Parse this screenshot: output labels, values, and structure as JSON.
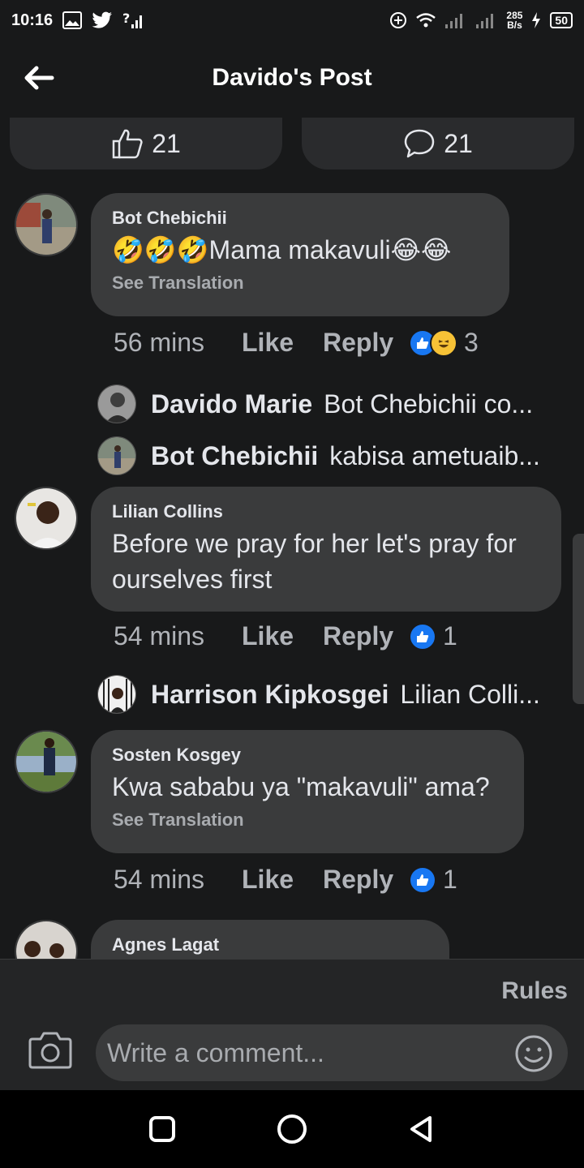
{
  "status_bar": {
    "time": "10:16",
    "net_speed_value": "285",
    "net_speed_unit": "B/s",
    "battery": "50"
  },
  "header": {
    "title": "Davido's Post"
  },
  "post_stats": {
    "likes": "21",
    "comments": "21"
  },
  "comments": [
    {
      "author": "Bot Chebichii",
      "text": "Mama makavuli",
      "see_translation": "See Translation",
      "time": "56 mins",
      "like_label": "Like",
      "reply_label": "Reply",
      "reaction_count": "3",
      "replies": [
        {
          "name": "Davido Marie",
          "snippet": "Bot Chebichii co..."
        },
        {
          "name": "Bot Chebichii",
          "snippet": "kabisa ametuaib..."
        }
      ]
    },
    {
      "author": "Lilian Collins",
      "text": "Before we pray for her let's pray for ourselves first",
      "time": "54 mins",
      "like_label": "Like",
      "reply_label": "Reply",
      "reaction_count": "1",
      "replies": [
        {
          "name": "Harrison Kipkosgei",
          "snippet": "Lilian Colli..."
        }
      ]
    },
    {
      "author": "Sosten Kosgey",
      "text": "Kwa sababu ya \"makavuli\" ama?",
      "see_translation": "See Translation",
      "time": "54 mins",
      "like_label": "Like",
      "reply_label": "Reply",
      "reaction_count": "1"
    },
    {
      "author": "Agnes Lagat"
    }
  ],
  "composer": {
    "rules": "Rules",
    "placeholder": "Write a comment..."
  },
  "colors": {
    "background": "#18191a",
    "bubble": "#3a3b3c",
    "like_blue": "#1877f2"
  }
}
